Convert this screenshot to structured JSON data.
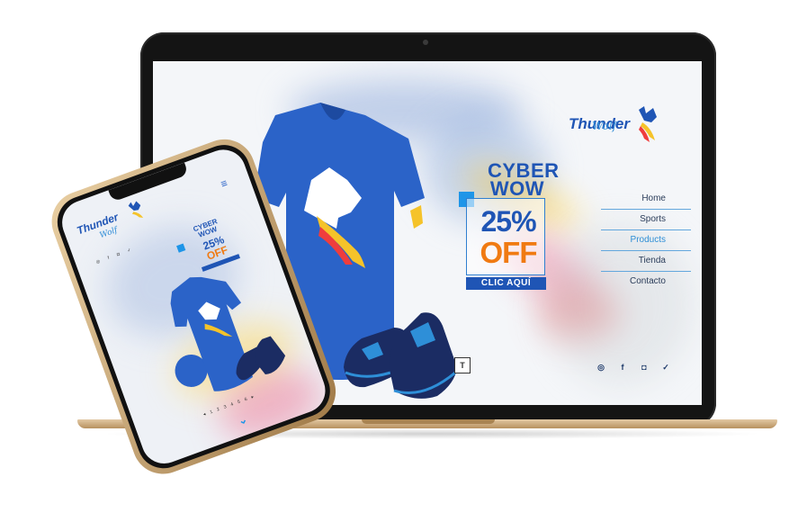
{
  "site": {
    "logo": {
      "word": "Thunder",
      "sub": "Wolf"
    },
    "promo": {
      "title_line1": "CYBER",
      "title_line2": "WOW",
      "percent": "25%",
      "off": "OFF",
      "cta": "CLIC AQUÍ"
    },
    "nav": [
      {
        "label": "Home"
      },
      {
        "label": "Sports"
      },
      {
        "label": "Products"
      },
      {
        "label": "Tienda"
      },
      {
        "label": "Contacto"
      }
    ],
    "social_icons": [
      "whatsapp-icon",
      "facebook-icon",
      "instagram-icon",
      "twitter-icon"
    ],
    "badge": "T",
    "colors": {
      "brand_blue": "#1f55b5",
      "accent_orange": "#f07a12",
      "active_nav": "#2f8fd6",
      "cta_bg": "#1f55b5"
    }
  },
  "mobile": {
    "logo": {
      "word": "Thunder",
      "sub": "Wolf"
    },
    "promo": {
      "title_line1": "CYBER",
      "title_line2": "WOW",
      "percent": "25%",
      "off": "OFF"
    },
    "menu_icon": "hamburger-icon",
    "scroll_icon": "chevron-down-icon"
  }
}
